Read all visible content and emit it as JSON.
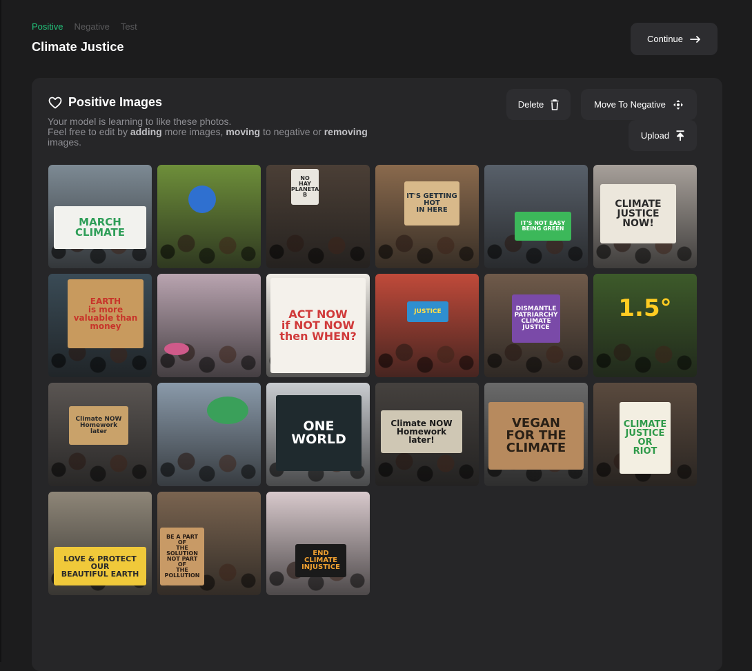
{
  "steps": [
    {
      "label": "Positive",
      "active": true
    },
    {
      "label": "Negative",
      "active": false
    },
    {
      "label": "Test",
      "active": false
    }
  ],
  "page_title": "Climate Justice",
  "continue_label": "Continue",
  "panel": {
    "title": "Positive Images",
    "desc_1": "Your model is learning to like these photos.",
    "desc_2": "Feel free to edit by ",
    "desc_adding": "adding",
    "desc_3": " more images, ",
    "desc_moving": "moving",
    "desc_4": " to negative or ",
    "desc_removing": "removing",
    "desc_5": "images."
  },
  "actions": {
    "delete_label": "Delete",
    "move_label": "Move To Negative",
    "upload_label": "Upload"
  },
  "colors": {
    "accent": "#22c27a",
    "background": "#1c1c1d",
    "panel": "#262628",
    "button": "#2d2d30"
  },
  "images": [
    {
      "name": "image-march-climate",
      "sign": "MARCH\nCLIMATE",
      "bg": "#7d8a94",
      "sign_bg": "#f2f2ee",
      "sign_fg": "#2f9e58"
    },
    {
      "name": "image-blue-balloon",
      "sign": "",
      "bg": "#6e8f3a",
      "sign_bg": "#2f70d0",
      "sign_fg": "#ffffff"
    },
    {
      "name": "image-girl-with-sign",
      "sign": "NO\nHAY\nPLANETA\nB",
      "bg": "#4b3f36",
      "sign_bg": "#e9e6df",
      "sign_fg": "#2b2b2b"
    },
    {
      "name": "image-its-getting-hot",
      "sign": "IT'S GETTING\nHOT\nIN HERE",
      "bg": "#8a6a4d",
      "sign_bg": "#d8b98a",
      "sign_fg": "#23303a"
    },
    {
      "name": "image-not-easy-being-green",
      "sign": "IT'S NOT EASY\nBEING GREEN",
      "bg": "#58606a",
      "sign_bg": "#3cb85a",
      "sign_fg": "#ffffff"
    },
    {
      "name": "image-climate-justice-now",
      "sign": "CLIMATE\nJUSTICE\nNOW!",
      "bg": "#a7a09a",
      "sign_bg": "#ece7dc",
      "sign_fg": "#2a2a2a"
    },
    {
      "name": "image-earth-valuable",
      "sign": "EARTH\nis more\nvaluable than money",
      "bg": "#3a4b56",
      "sign_bg": "#c89a5e",
      "sign_fg": "#c7352a"
    },
    {
      "name": "image-capitol-march",
      "sign": "",
      "bg": "#b9a4b0",
      "sign_bg": "#d05a8a",
      "sign_fg": "#ffffff"
    },
    {
      "name": "image-act-now",
      "sign": "ACT NOW\nif NOT NOW\nthen WHEN?",
      "bg": "#efece6",
      "sign_bg": "#f4f1eb",
      "sign_fg": "#d03a3a"
    },
    {
      "name": "image-colorful-banners",
      "sign": "JUSTICE",
      "bg": "#c04a3a",
      "sign_bg": "#2f8fd0",
      "sign_fg": "#ffde4a"
    },
    {
      "name": "image-dismantle-patriarchy",
      "sign": "DISMANTLE\nPATRIARCHY\nCLIMATE\nJUSTICE",
      "bg": "#6f5a4a",
      "sign_bg": "#7a4aa8",
      "sign_fg": "#ffffff"
    },
    {
      "name": "image-one-point-five-degrees",
      "sign": "1.5°",
      "bg": "#3d5a2a",
      "sign_bg": "transparent",
      "sign_fg": "#ffcc22"
    },
    {
      "name": "image-climate-now-homework",
      "sign": "Climate NOW\nHomework later",
      "bg": "#5a5552",
      "sign_bg": "#c9a26a",
      "sign_fg": "#2a2a2a"
    },
    {
      "name": "image-globe-flag",
      "sign": "",
      "bg": "#8a9aaa",
      "sign_bg": "#3aa05a",
      "sign_fg": "#ffffff"
    },
    {
      "name": "image-one-world",
      "sign": "ONE\nWORLD",
      "bg": "#c9ccd0",
      "sign_bg": "#1f2a2e",
      "sign_fg": "#ffffff"
    },
    {
      "name": "image-climate-now-sign",
      "sign": "Climate NOW\nHomework later!",
      "bg": "#45413e",
      "sign_bg": "#cfc7b4",
      "sign_fg": "#1a1a1a"
    },
    {
      "name": "image-vegan-for-the-climate",
      "sign": "VEGAN\nFOR THE\nCLIMATE",
      "bg": "#6a6a6a",
      "sign_bg": "#b78a5e",
      "sign_fg": "#2a2016"
    },
    {
      "name": "image-climate-justice-or-riot",
      "sign": "CLIMATE\nJUSTICE\nOR\nRIOT",
      "bg": "#5a4a3e",
      "sign_bg": "#f3efe2",
      "sign_fg": "#2f9a4a"
    },
    {
      "name": "image-love-and-protect-earth",
      "sign": "LOVE & PROTECT\nOUR\nBEAUTIFUL EARTH",
      "bg": "#8e8678",
      "sign_bg": "#f0c93a",
      "sign_fg": "#2a2a2a"
    },
    {
      "name": "image-be-part-of-solution",
      "sign": "BE A PART OF\nTHE SOLUTION\nNOT PART OF\nTHE POLLUTION",
      "bg": "#7a6450",
      "sign_bg": "#c89a66",
      "sign_fg": "#2a1e16"
    },
    {
      "name": "image-end-climate-injustice",
      "sign": "END\nCLIMATE\nINJUSTICE",
      "bg": "#d8c9cc",
      "sign_bg": "#1a1a1a",
      "sign_fg": "#f0a030"
    }
  ]
}
